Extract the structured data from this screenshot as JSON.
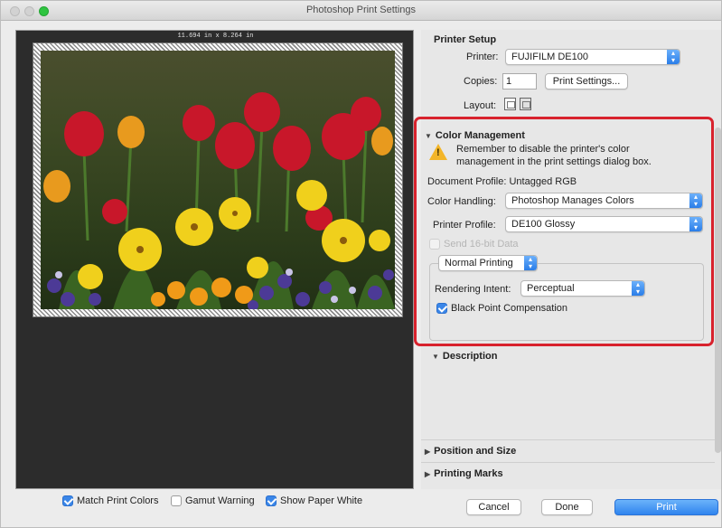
{
  "window": {
    "title": "Photoshop Print Settings"
  },
  "preview": {
    "dimensions_label": "11.694 in x 8.264 in"
  },
  "bottom_checkboxes": [
    {
      "label": "Match Print Colors",
      "checked": true
    },
    {
      "label": "Gamut Warning",
      "checked": false
    },
    {
      "label": "Show Paper White",
      "checked": true
    }
  ],
  "printer_setup": {
    "heading": "Printer Setup",
    "printer_label": "Printer:",
    "printer_value": "FUJIFILM DE100",
    "copies_label": "Copies:",
    "copies_value": "1",
    "print_settings_button": "Print Settings...",
    "layout_label": "Layout:"
  },
  "color_management": {
    "heading": "Color Management",
    "warning_text_line1": "Remember to disable the printer's color",
    "warning_text_line2": "management in the print settings dialog box.",
    "document_profile": "Document Profile: Untagged RGB",
    "color_handling_label": "Color Handling:",
    "color_handling_value": "Photoshop Manages Colors",
    "printer_profile_label": "Printer Profile:",
    "printer_profile_value": "DE100 Glossy",
    "send_16bit_label": "Send 16-bit Data",
    "printing_mode": "Normal Printing",
    "rendering_intent_label": "Rendering Intent:",
    "rendering_intent_value": "Perceptual",
    "black_point_label": "Black Point Compensation",
    "black_point_checked": true
  },
  "sections": {
    "description": "Description",
    "position_and_size": "Position and Size",
    "printing_marks": "Printing Marks"
  },
  "buttons": {
    "cancel": "Cancel",
    "done": "Done",
    "print": "Print"
  },
  "colors": {
    "highlight_outline": "#d8222d",
    "accent": "#2f84ee",
    "warning": "#f3b528"
  },
  "icons": [
    "warning-icon",
    "disclosure-triangle-icon",
    "popup-stepper-icon",
    "layout-portrait-icon",
    "layout-landscape-icon"
  ]
}
